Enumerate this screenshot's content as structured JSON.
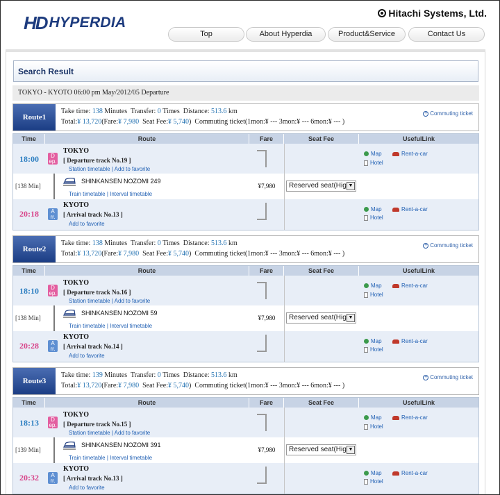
{
  "header": {
    "logo_mark": "HD",
    "logo_text": "HYPERDIA",
    "corp": "Hitachi Systems, Ltd.",
    "nav": [
      "Top",
      "About Hyperdia",
      "Product&Service",
      "Contact Us"
    ]
  },
  "search_result": {
    "title": "Search Result",
    "condition": "TOKYO - KYOTO   06:00 pm  May/2012/05   Departure"
  },
  "table_headers": [
    "Time",
    "Route",
    "Fare",
    "Seat Fee",
    "UsefulLink"
  ],
  "useful_links": {
    "map": "Map",
    "rent": "Rent-a-car",
    "hotel": "Hotel"
  },
  "commuting_link": "Commuting ticket",
  "routes": [
    {
      "label": "Route1",
      "take_time": "138",
      "transfer": "0",
      "distance": "513.6",
      "total": "¥ 13,720",
      "fare": "¥ 7,980",
      "seat_fee": "¥ 5,740",
      "dep_time": "18:00",
      "dep_station": "TOKYO",
      "dep_track": "[ Departure track No.19 ]",
      "dep_links": "Station timetable | Add to favorite",
      "minutes": "[138 Min]",
      "train": "SHINKANSEN NOZOMI 249",
      "train_links": "Train timetable | Interval timetable",
      "train_fare": "¥7,980",
      "seat": "Reserved seat(Hig",
      "arr_time": "20:18",
      "arr_station": "KYOTO",
      "arr_track": "[ Arrival track No.13 ]",
      "arr_links": "Add to favorite"
    },
    {
      "label": "Route2",
      "take_time": "138",
      "transfer": "0",
      "distance": "513.6",
      "total": "¥ 13,720",
      "fare": "¥ 7,980",
      "seat_fee": "¥ 5,740",
      "dep_time": "18:10",
      "dep_station": "TOKYO",
      "dep_track": "[ Departure track No.16 ]",
      "dep_links": "Station timetable | Add to favorite",
      "minutes": "[138 Min]",
      "train": "SHINKANSEN NOZOMI 59",
      "train_links": "Train timetable | Interval timetable",
      "train_fare": "¥7,980",
      "seat": "Reserved seat(Hig",
      "arr_time": "20:28",
      "arr_station": "KYOTO",
      "arr_track": "[ Arrival track No.14 ]",
      "arr_links": "Add to favorite"
    },
    {
      "label": "Route3",
      "take_time": "139",
      "transfer": "0",
      "distance": "513.6",
      "total": "¥ 13,720",
      "fare": "¥ 7,980",
      "seat_fee": "¥ 5,740",
      "dep_time": "18:13",
      "dep_station": "TOKYO",
      "dep_track": "[ Departure track No.15 ]",
      "dep_links": "Station timetable | Add to favorite",
      "minutes": "[139 Min]",
      "train": "SHINKANSEN NOZOMI 391",
      "train_links": "Train timetable | Interval timetable",
      "train_fare": "¥7,980",
      "seat": "Reserved seat(Hig",
      "arr_time": "20:32",
      "arr_station": "KYOTO",
      "arr_track": "[ Arrival track No.13 ]",
      "arr_links": "Add to favorite"
    }
  ],
  "labels": {
    "take_time": "Take time:",
    "minutes": "Minutes",
    "transfer": "Transfer:",
    "times": "Times",
    "distance": "Distance:",
    "km": "km",
    "total": "Total:",
    "fare_open": "(Fare:",
    "seat_fee": "Seat Fee:",
    "close": ")",
    "commuting": "Commuting ticket(1mon:¥ ---    3mon:¥ ---    6mon:¥ --- )",
    "dep_badge": "D ep.",
    "arr_badge": "A rr."
  }
}
